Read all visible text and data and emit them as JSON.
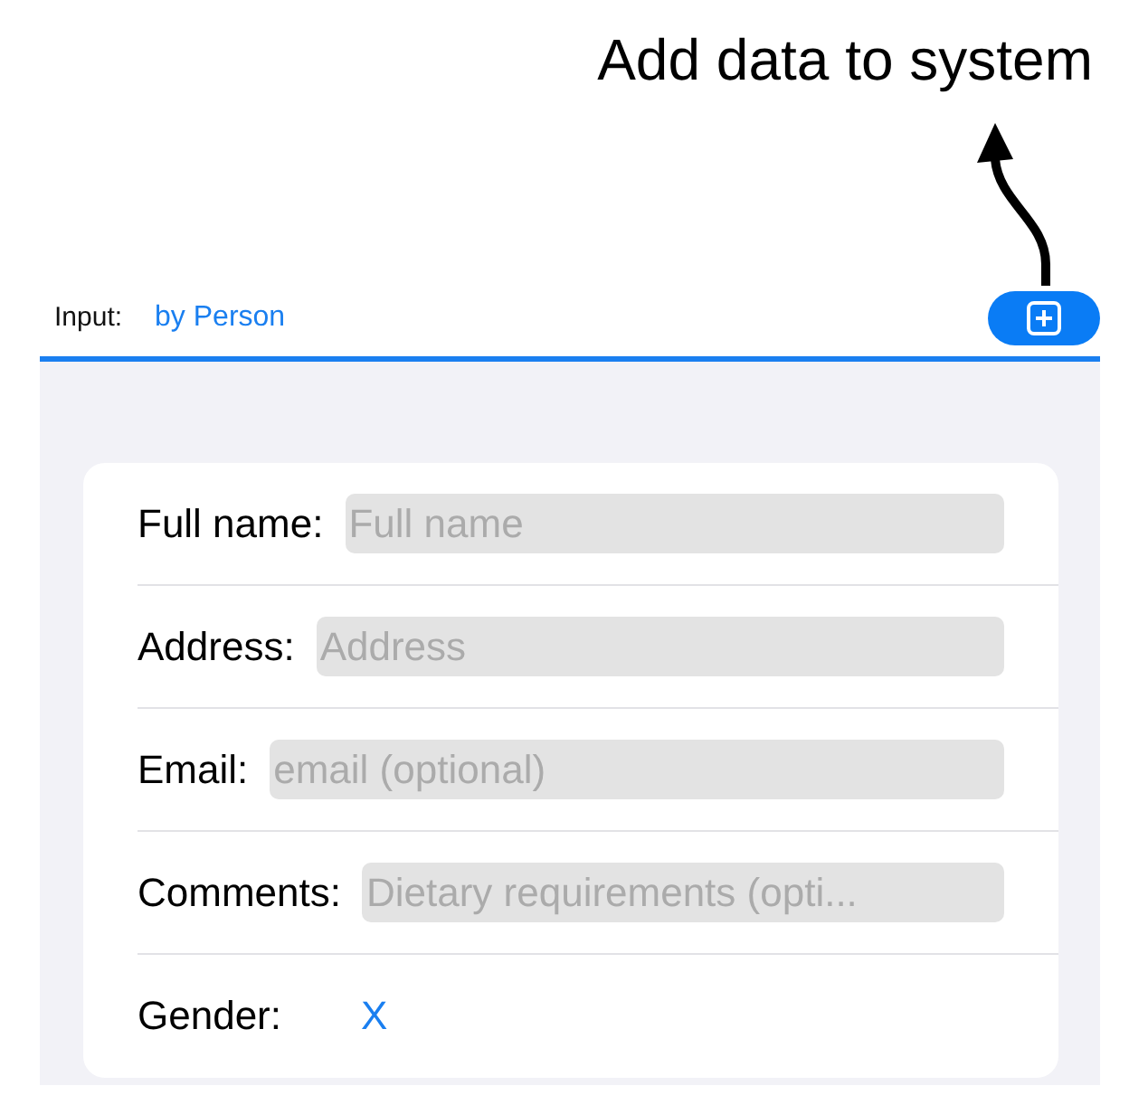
{
  "annotation": {
    "text": "Add data to system"
  },
  "toolbar": {
    "label": "Input:",
    "mode": "by Person"
  },
  "form": {
    "fields": [
      {
        "kind": "text",
        "label": "Full name:",
        "placeholder": "Full name"
      },
      {
        "kind": "text",
        "label": "Address:",
        "placeholder": "Address"
      },
      {
        "kind": "text",
        "label": "Email:",
        "placeholder": "email (optional)"
      },
      {
        "kind": "text",
        "label": "Comments:",
        "placeholder": "Dietary requirements (opti..."
      },
      {
        "kind": "choice",
        "label": "Gender:",
        "value": "X"
      }
    ]
  }
}
